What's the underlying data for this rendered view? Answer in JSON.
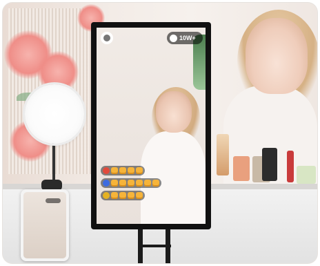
{
  "scene": {
    "kind": "livestream-display-photo"
  },
  "stream_overlay": {
    "viewer_count": "10W+",
    "comments": [
      {
        "avatar_color": "#e24a3b",
        "hands": 4
      },
      {
        "avatar_color": "#3d6be0",
        "hands": 6
      },
      {
        "avatar_color": "#e5b222",
        "hands": 4
      }
    ]
  },
  "colors": {
    "frame": "#111111",
    "overlay_pill": "#000000",
    "hand_emoji": "#f6b43a"
  }
}
